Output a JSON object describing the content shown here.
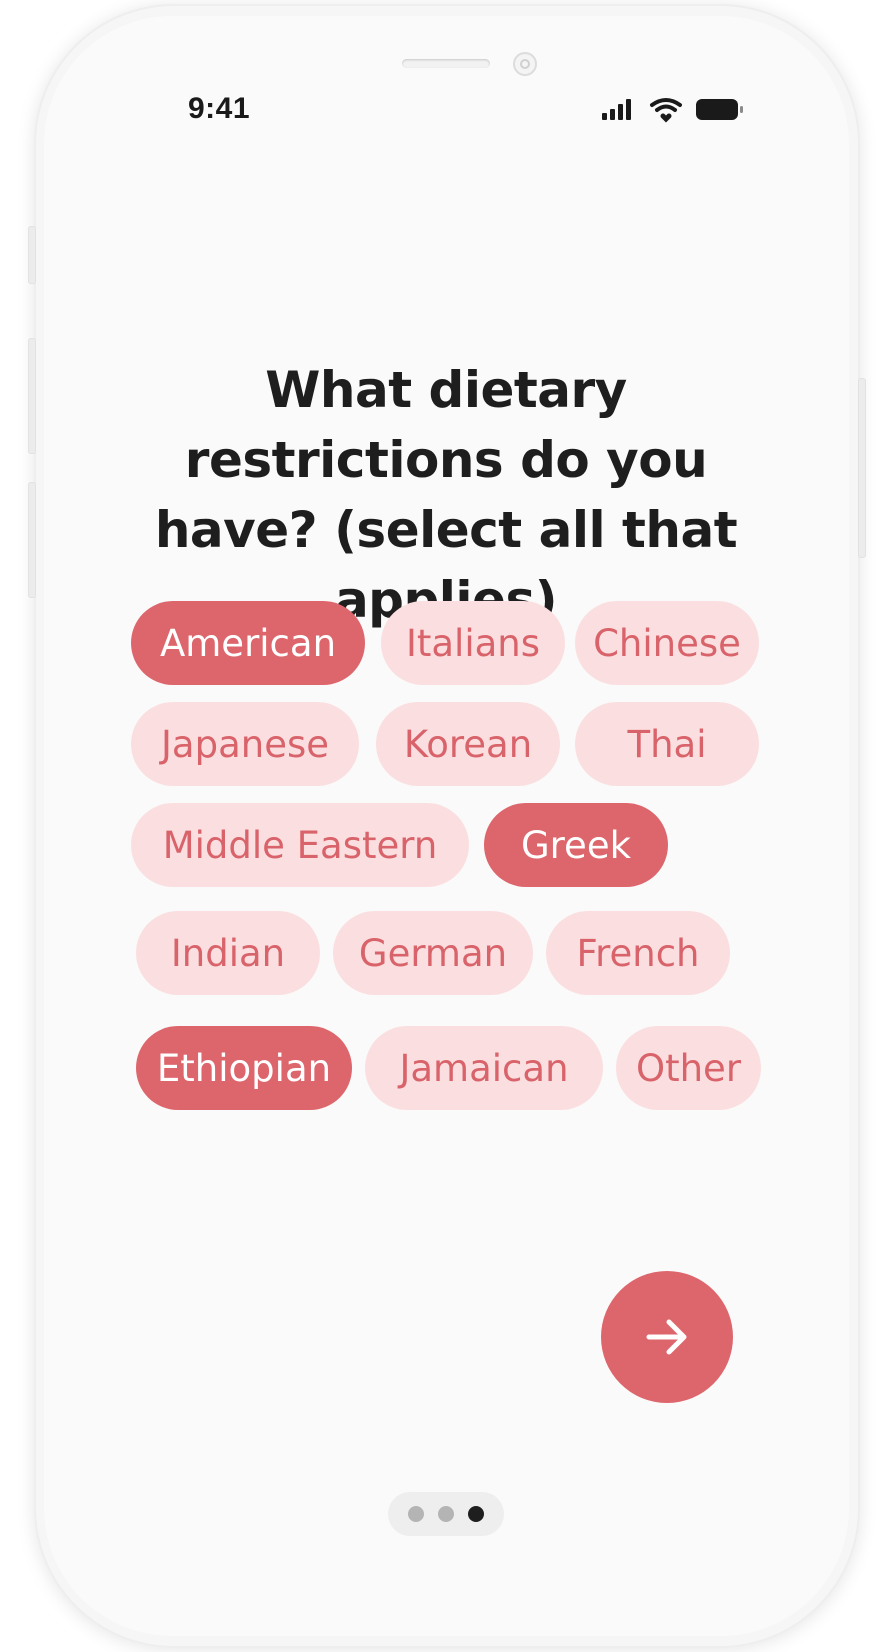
{
  "status_bar": {
    "time": "9:41",
    "icons": [
      "signal-icon",
      "wifi-icon",
      "battery-icon"
    ]
  },
  "question": {
    "title": "What dietary restrictions do you have? (select all that applies)"
  },
  "options": [
    {
      "label": "American",
      "selected": true
    },
    {
      "label": "Italians",
      "selected": false
    },
    {
      "label": "Chinese",
      "selected": false
    },
    {
      "label": "Japanese",
      "selected": false
    },
    {
      "label": "Korean",
      "selected": false
    },
    {
      "label": "Thai",
      "selected": false
    },
    {
      "label": "Middle Eastern",
      "selected": false
    },
    {
      "label": "Greek",
      "selected": true
    },
    {
      "label": "Indian",
      "selected": false
    },
    {
      "label": "German",
      "selected": false
    },
    {
      "label": "French",
      "selected": false
    },
    {
      "label": "Ethiopian",
      "selected": true
    },
    {
      "label": "Jamaican",
      "selected": false
    },
    {
      "label": "Other",
      "selected": false
    }
  ],
  "next_button": {
    "icon": "arrow-right-icon"
  },
  "pagination": {
    "total": 3,
    "current": 3
  },
  "colors": {
    "accent": "#dd666c",
    "chip_unselected_bg": "#fbdfe0",
    "chip_unselected_text": "#d9636a",
    "title": "#1e1e1e"
  }
}
